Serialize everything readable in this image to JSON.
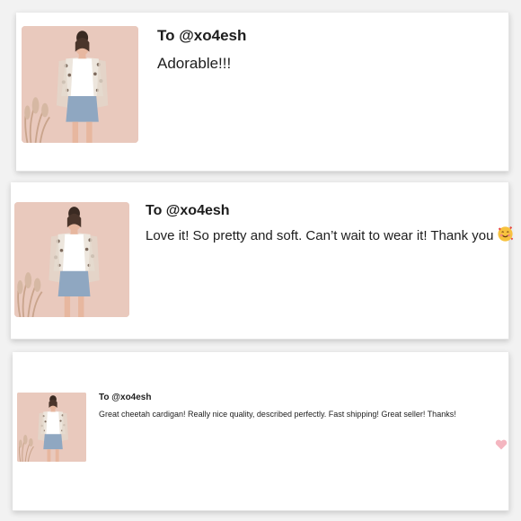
{
  "reviews": [
    {
      "recipient": "To @xo4esh",
      "comment": "Adorable!!!"
    },
    {
      "recipient": "To @xo4esh",
      "comment": "Love it! So pretty and soft. Can’t wait to wear it! Thank you",
      "emoji": "smiling-face-with-hearts-icon"
    },
    {
      "recipient": "To @xo4esh",
      "comment": "Great cheetah cardigan! Really nice quality, described perfectly. Fast shipping! Great seller! Thanks!",
      "action_icon": "heart-icon"
    }
  ],
  "colors": {
    "thumbnail_background": "#e9c9bd",
    "heart": "#f4b6c0",
    "text": "#1d1d1d"
  }
}
